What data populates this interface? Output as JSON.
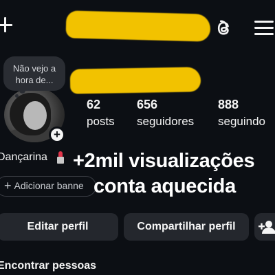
{
  "header": {
    "new_post_icon": "plus-icon",
    "threads_icon": "threads-icon",
    "menu_icon": "hamburger-menu-icon"
  },
  "note": {
    "text_line1": "Não vejo a",
    "text_line2": "hora de..."
  },
  "stats": [
    {
      "value": "62",
      "label": "posts"
    },
    {
      "value": "656",
      "label": "seguidores"
    },
    {
      "value": "888",
      "label": "seguindo"
    }
  ],
  "bio": {
    "text": "Dançarina",
    "emoji": "lipstick-icon"
  },
  "overlay": {
    "line1": "+2mil visualizações",
    "line2": "conta aquecida"
  },
  "banner": {
    "label": "Adicionar banne"
  },
  "actions": {
    "edit_profile": "Editar perfil",
    "share_profile": "Compartilhar perfil",
    "add_person_icon": "add-person-icon"
  },
  "section": {
    "find_people": "Encontrar pessoas"
  },
  "colors": {
    "background": "#0c0f14",
    "button_bg": "#24272d",
    "redaction": "#f2c200"
  }
}
